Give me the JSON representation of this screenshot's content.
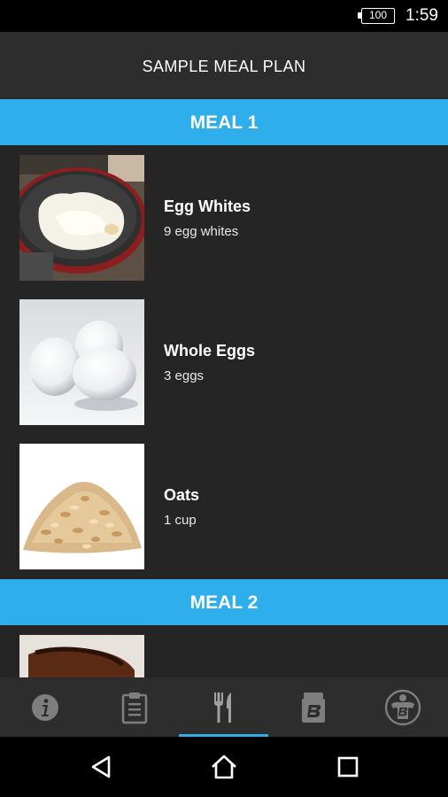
{
  "status_bar": {
    "battery": "100",
    "time": "1:59"
  },
  "header": {
    "title": "SAMPLE MEAL PLAN"
  },
  "meals": [
    {
      "title": "MEAL 1",
      "items": [
        {
          "name": "Egg Whites",
          "quantity": "9 egg whites",
          "image": "egg-whites-image"
        },
        {
          "name": "Whole Eggs",
          "quantity": "3 eggs",
          "image": "whole-eggs-image"
        },
        {
          "name": "Oats",
          "quantity": "1 cup",
          "image": "oats-image"
        }
      ]
    },
    {
      "title": "MEAL 2"
    }
  ],
  "bottom_nav": {
    "items": [
      "info-icon",
      "clipboard-icon",
      "fork-knife-icon",
      "supplement-jar-icon",
      "bodybuilder-icon"
    ],
    "active_index": 2,
    "active_color": "#2eaeeb"
  },
  "theme": {
    "accent": "#2eaeeb",
    "background": "#252525",
    "header": "#2d2d2d"
  }
}
